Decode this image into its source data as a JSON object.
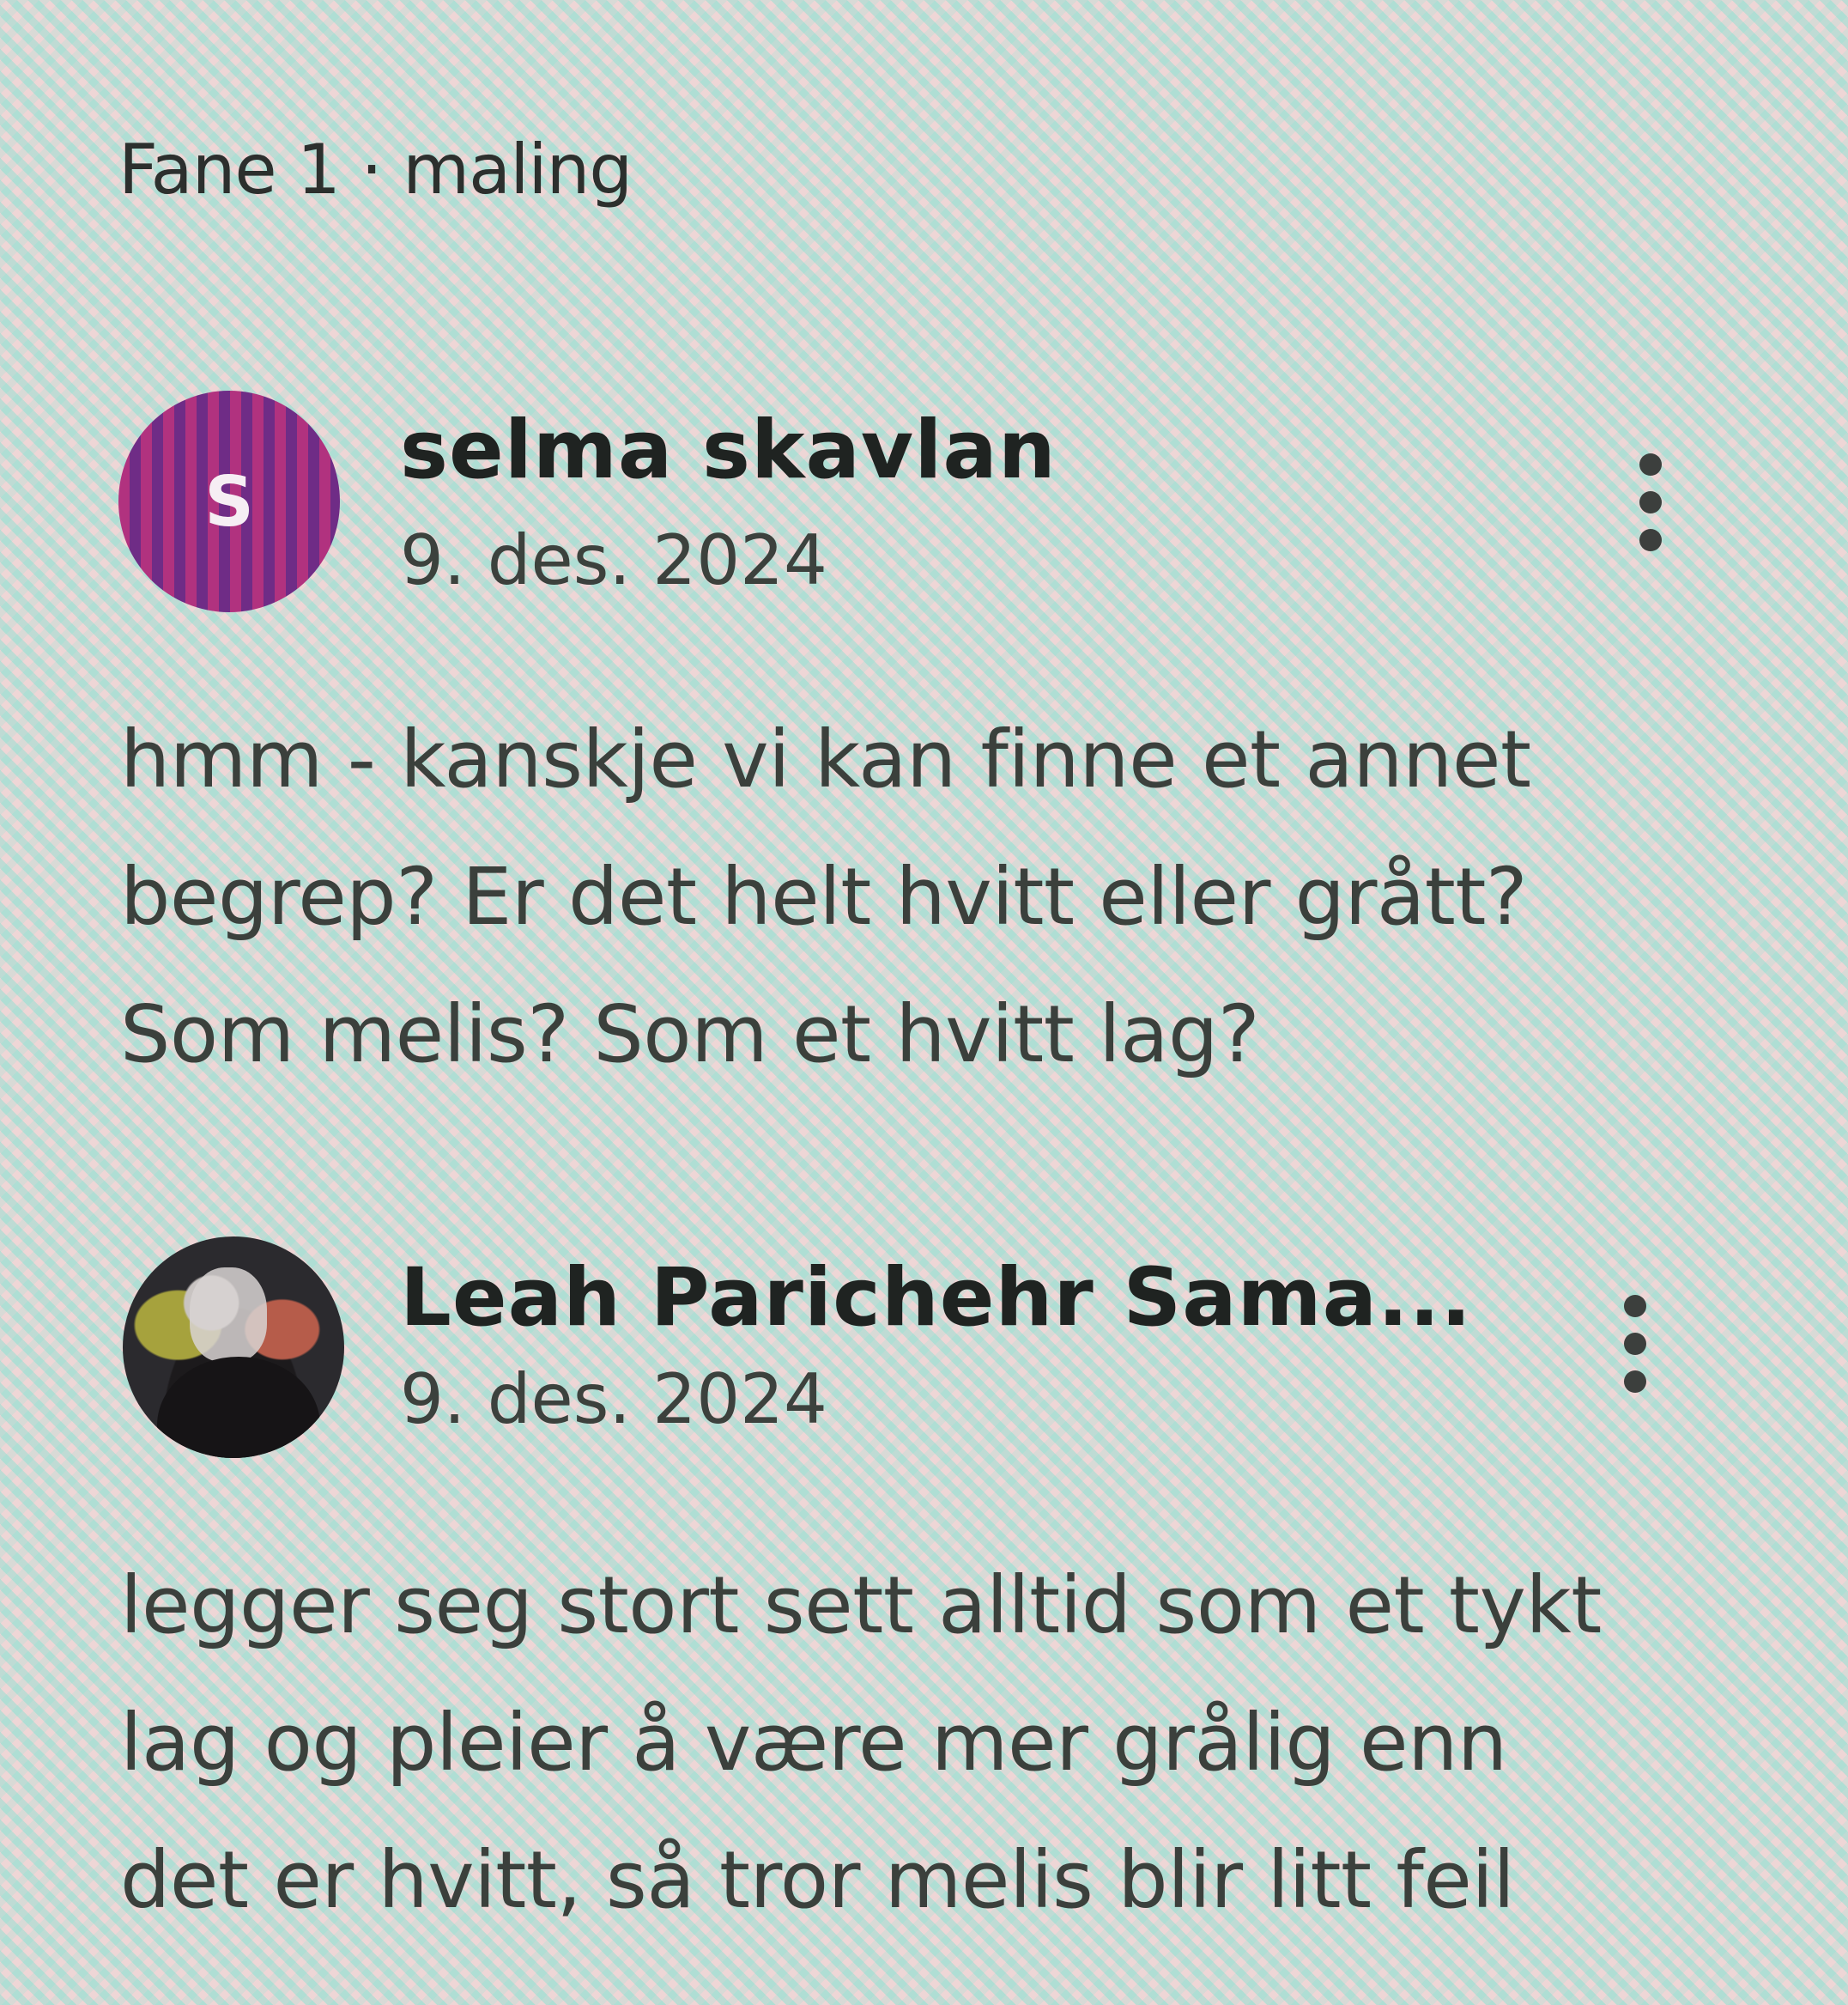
{
  "header": {
    "title": "Fane 1 · maling"
  },
  "comments": [
    {
      "avatar_letter": "S",
      "author": "selma skavlan",
      "date": "9. des. 2024",
      "menu_icon": "more-vertical-icon",
      "lines": [
        "hmm - kanskje vi kan finne et annet",
        "begrep? Er det helt hvitt eller grått?",
        "Som melis? Som et hvitt lag?"
      ]
    },
    {
      "avatar_letter": "",
      "author": "Leah Parichehr Sama...",
      "date": "9. des. 2024",
      "menu_icon": "more-vertical-icon",
      "lines": [
        "legger seg stort sett alltid som et tykt",
        "lag og pleier å være mer grålig enn",
        "det er hvitt, så tror melis blir litt feil"
      ]
    }
  ],
  "colors": {
    "avatar_stripe_a": "#b1327f",
    "avatar_stripe_b": "#6f2c86",
    "text": "#3b403c"
  }
}
